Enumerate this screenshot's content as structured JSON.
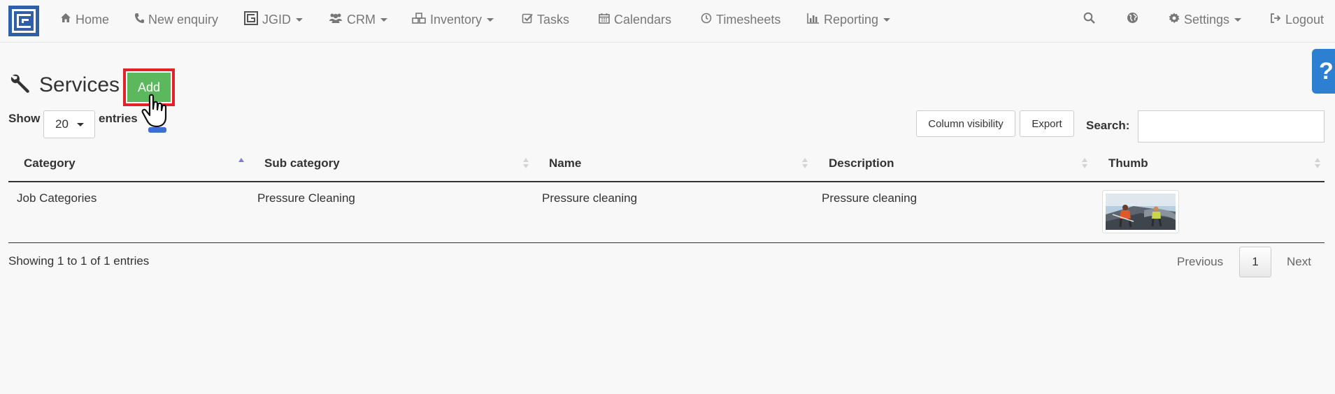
{
  "navbar": {
    "items": [
      {
        "label": "Home",
        "icon": "home-icon"
      },
      {
        "label": "New enquiry",
        "icon": "phone-icon"
      },
      {
        "label": "JGID",
        "icon": "jgid-icon",
        "dropdown": true
      },
      {
        "label": "CRM",
        "icon": "users-icon",
        "dropdown": true
      },
      {
        "label": "Inventory",
        "icon": "cubes-icon",
        "dropdown": true
      },
      {
        "label": "Tasks",
        "icon": "checkbox-icon"
      },
      {
        "label": "Calendars",
        "icon": "calendar-icon"
      },
      {
        "label": "Timesheets",
        "icon": "clock-icon"
      },
      {
        "label": "Reporting",
        "icon": "bar-chart-icon",
        "dropdown": true
      }
    ],
    "right": {
      "settings_label": "Settings",
      "logout_label": "Logout"
    }
  },
  "help_tab": {
    "label": "?"
  },
  "page": {
    "title": "Services",
    "add_label": "Add"
  },
  "table_controls": {
    "show_label": "Show",
    "length_value": "20",
    "entries_label": "entries",
    "column_visibility_label": "Column visibility",
    "export_label": "Export",
    "search_label": "Search:",
    "search_value": ""
  },
  "table": {
    "columns": [
      "Category",
      "Sub category",
      "Name",
      "Description",
      "Thumb"
    ],
    "sorted_column": "Category",
    "rows": [
      {
        "category": "Job Categories",
        "sub_category": "Pressure Cleaning",
        "name": "Pressure cleaning",
        "description": "Pressure cleaning"
      }
    ]
  },
  "footer": {
    "info": "Showing 1 to 1 of 1 entries",
    "previous_label": "Previous",
    "current_page": "1",
    "next_label": "Next"
  },
  "colors": {
    "add_button": "#5cb85c",
    "highlight_border": "#e32228",
    "help_tab": "#2d7fd1",
    "logo": "#2f5fa6"
  }
}
